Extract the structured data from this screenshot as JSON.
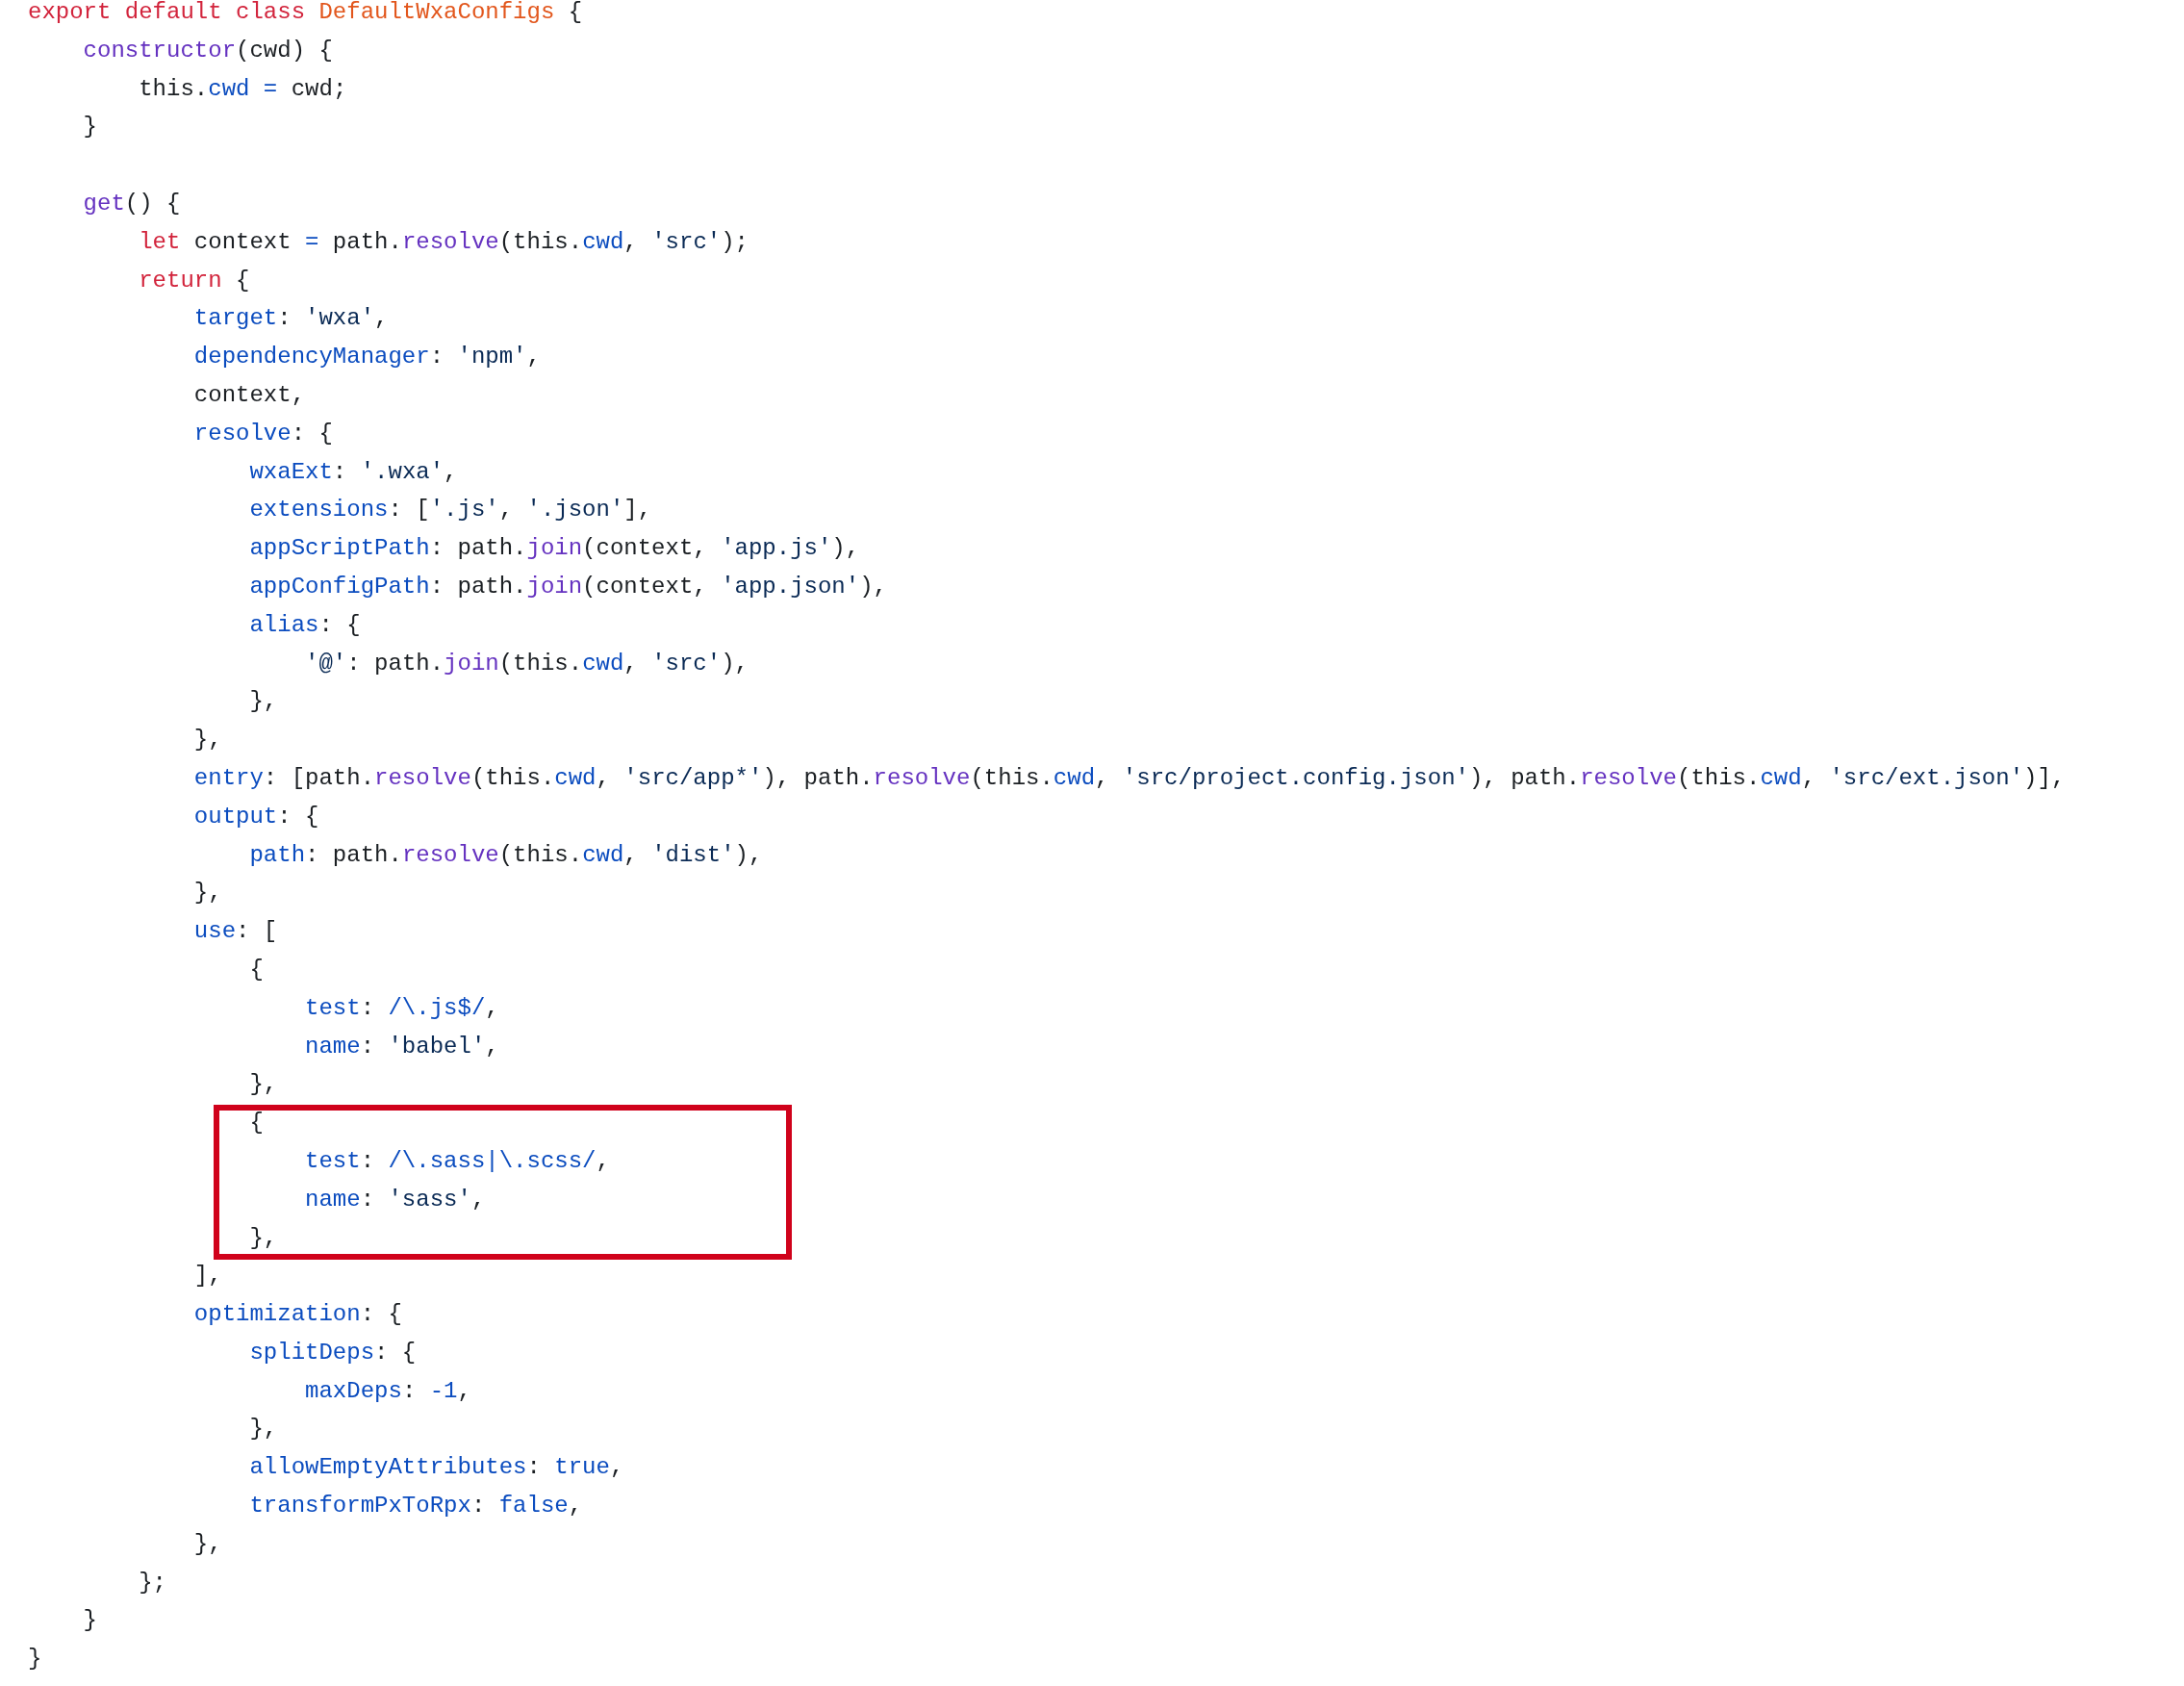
{
  "code": {
    "lines": [
      {
        "kind": "code",
        "tokens": [
          {
            "kind": "kw",
            "text": "export default class "
          },
          {
            "kind": "cls",
            "text": "DefaultWxaConfigs"
          },
          {
            "kind": "txt",
            "text": " {"
          }
        ]
      },
      {
        "kind": "code",
        "tokens": [
          {
            "kind": "fn",
            "text": "    constructor"
          },
          {
            "kind": "txt",
            "text": "(cwd) {"
          }
        ]
      },
      {
        "kind": "code",
        "tokens": [
          {
            "kind": "txt",
            "text": "        this."
          },
          {
            "kind": "prop",
            "text": "cwd"
          },
          {
            "kind": "num",
            "text": " ="
          },
          {
            "kind": "txt",
            "text": " cwd;"
          }
        ]
      },
      {
        "kind": "code",
        "tokens": [
          {
            "kind": "txt",
            "text": "    }"
          }
        ]
      },
      {
        "kind": "blank"
      },
      {
        "kind": "code",
        "tokens": [
          {
            "kind": "fn",
            "text": "    get"
          },
          {
            "kind": "txt",
            "text": "() {"
          }
        ]
      },
      {
        "kind": "code",
        "tokens": [
          {
            "kind": "kw",
            "text": "        let"
          },
          {
            "kind": "txt",
            "text": " context"
          },
          {
            "kind": "num",
            "text": " ="
          },
          {
            "kind": "txt",
            "text": " path."
          },
          {
            "kind": "fn",
            "text": "resolve"
          },
          {
            "kind": "txt",
            "text": "(this."
          },
          {
            "kind": "prop",
            "text": "cwd"
          },
          {
            "kind": "txt",
            "text": ","
          },
          {
            "kind": "str",
            "text": " 'src'"
          },
          {
            "kind": "txt",
            "text": ");"
          }
        ]
      },
      {
        "kind": "code",
        "tokens": [
          {
            "kind": "kw",
            "text": "        return"
          },
          {
            "kind": "txt",
            "text": " {"
          }
        ]
      },
      {
        "kind": "code",
        "tokens": [
          {
            "kind": "prop",
            "text": "            target"
          },
          {
            "kind": "txt",
            "text": ":"
          },
          {
            "kind": "str",
            "text": " 'wxa'"
          },
          {
            "kind": "txt",
            "text": ","
          }
        ]
      },
      {
        "kind": "code",
        "tokens": [
          {
            "kind": "prop",
            "text": "            dependencyManager"
          },
          {
            "kind": "txt",
            "text": ":"
          },
          {
            "kind": "str",
            "text": " 'npm'"
          },
          {
            "kind": "txt",
            "text": ","
          }
        ]
      },
      {
        "kind": "code",
        "tokens": [
          {
            "kind": "txt",
            "text": "            context,"
          }
        ]
      },
      {
        "kind": "code",
        "tokens": [
          {
            "kind": "prop",
            "text": "            resolve"
          },
          {
            "kind": "txt",
            "text": ": {"
          }
        ]
      },
      {
        "kind": "code",
        "tokens": [
          {
            "kind": "prop",
            "text": "                wxaExt"
          },
          {
            "kind": "txt",
            "text": ":"
          },
          {
            "kind": "str",
            "text": " '.wxa'"
          },
          {
            "kind": "txt",
            "text": ","
          }
        ]
      },
      {
        "kind": "code",
        "tokens": [
          {
            "kind": "prop",
            "text": "                extensions"
          },
          {
            "kind": "txt",
            "text": ": ["
          },
          {
            "kind": "str",
            "text": "'.js'"
          },
          {
            "kind": "txt",
            "text": ","
          },
          {
            "kind": "str",
            "text": " '.json'"
          },
          {
            "kind": "txt",
            "text": "],"
          }
        ]
      },
      {
        "kind": "code",
        "tokens": [
          {
            "kind": "prop",
            "text": "                appScriptPath"
          },
          {
            "kind": "txt",
            "text": ": path."
          },
          {
            "kind": "fn",
            "text": "join"
          },
          {
            "kind": "txt",
            "text": "(context,"
          },
          {
            "kind": "str",
            "text": " 'app.js'"
          },
          {
            "kind": "txt",
            "text": "),"
          }
        ]
      },
      {
        "kind": "code",
        "tokens": [
          {
            "kind": "prop",
            "text": "                appConfigPath"
          },
          {
            "kind": "txt",
            "text": ": path."
          },
          {
            "kind": "fn",
            "text": "join"
          },
          {
            "kind": "txt",
            "text": "(context,"
          },
          {
            "kind": "str",
            "text": " 'app.json'"
          },
          {
            "kind": "txt",
            "text": "),"
          }
        ]
      },
      {
        "kind": "code",
        "tokens": [
          {
            "kind": "prop",
            "text": "                alias"
          },
          {
            "kind": "txt",
            "text": ": {"
          }
        ]
      },
      {
        "kind": "code",
        "tokens": [
          {
            "kind": "str",
            "text": "                    '@'"
          },
          {
            "kind": "txt",
            "text": ": path."
          },
          {
            "kind": "fn",
            "text": "join"
          },
          {
            "kind": "txt",
            "text": "(this."
          },
          {
            "kind": "prop",
            "text": "cwd"
          },
          {
            "kind": "txt",
            "text": ","
          },
          {
            "kind": "str",
            "text": " 'src'"
          },
          {
            "kind": "txt",
            "text": "),"
          }
        ]
      },
      {
        "kind": "code",
        "tokens": [
          {
            "kind": "txt",
            "text": "                },"
          }
        ]
      },
      {
        "kind": "code",
        "tokens": [
          {
            "kind": "txt",
            "text": "            },"
          }
        ]
      },
      {
        "kind": "code",
        "tokens": [
          {
            "kind": "prop",
            "text": "            entry"
          },
          {
            "kind": "txt",
            "text": ": [path."
          },
          {
            "kind": "fn",
            "text": "resolve"
          },
          {
            "kind": "txt",
            "text": "(this."
          },
          {
            "kind": "prop",
            "text": "cwd"
          },
          {
            "kind": "txt",
            "text": ","
          },
          {
            "kind": "str",
            "text": " 'src/app*'"
          },
          {
            "kind": "txt",
            "text": "), path."
          },
          {
            "kind": "fn",
            "text": "resolve"
          },
          {
            "kind": "txt",
            "text": "(this."
          },
          {
            "kind": "prop",
            "text": "cwd"
          },
          {
            "kind": "txt",
            "text": ","
          },
          {
            "kind": "str",
            "text": " 'src/project.config.json'"
          },
          {
            "kind": "txt",
            "text": "), path."
          },
          {
            "kind": "fn",
            "text": "resolve"
          },
          {
            "kind": "txt",
            "text": "(this."
          },
          {
            "kind": "prop",
            "text": "cwd"
          },
          {
            "kind": "txt",
            "text": ","
          },
          {
            "kind": "str",
            "text": " 'src/ext.json'"
          },
          {
            "kind": "txt",
            "text": ")],"
          }
        ]
      },
      {
        "kind": "code",
        "tokens": [
          {
            "kind": "prop",
            "text": "            output"
          },
          {
            "kind": "txt",
            "text": ": {"
          }
        ]
      },
      {
        "kind": "code",
        "tokens": [
          {
            "kind": "prop",
            "text": "                path"
          },
          {
            "kind": "txt",
            "text": ": path."
          },
          {
            "kind": "fn",
            "text": "resolve"
          },
          {
            "kind": "txt",
            "text": "(this."
          },
          {
            "kind": "prop",
            "text": "cwd"
          },
          {
            "kind": "txt",
            "text": ","
          },
          {
            "kind": "str",
            "text": " 'dist'"
          },
          {
            "kind": "txt",
            "text": "),"
          }
        ]
      },
      {
        "kind": "code",
        "tokens": [
          {
            "kind": "txt",
            "text": "            },"
          }
        ]
      },
      {
        "kind": "code",
        "tokens": [
          {
            "kind": "prop",
            "text": "            use"
          },
          {
            "kind": "txt",
            "text": ": ["
          }
        ]
      },
      {
        "kind": "code",
        "tokens": [
          {
            "kind": "txt",
            "text": "                {"
          }
        ]
      },
      {
        "kind": "code",
        "tokens": [
          {
            "kind": "prop",
            "text": "                    test"
          },
          {
            "kind": "txt",
            "text": ":"
          },
          {
            "kind": "num",
            "text": " /\\.js$/"
          },
          {
            "kind": "txt",
            "text": ","
          }
        ]
      },
      {
        "kind": "code",
        "tokens": [
          {
            "kind": "prop",
            "text": "                    name"
          },
          {
            "kind": "txt",
            "text": ":"
          },
          {
            "kind": "str",
            "text": " 'babel'"
          },
          {
            "kind": "txt",
            "text": ","
          }
        ]
      },
      {
        "kind": "code",
        "tokens": [
          {
            "kind": "txt",
            "text": "                },"
          }
        ]
      },
      {
        "kind": "code",
        "boxed": true,
        "tokens": [
          {
            "kind": "txt",
            "text": "                {"
          }
        ]
      },
      {
        "kind": "code",
        "boxed": true,
        "tokens": [
          {
            "kind": "prop",
            "text": "                    test"
          },
          {
            "kind": "txt",
            "text": ":"
          },
          {
            "kind": "num",
            "text": " /\\.sass|\\.scss/"
          },
          {
            "kind": "txt",
            "text": ","
          }
        ]
      },
      {
        "kind": "code",
        "boxed": true,
        "tokens": [
          {
            "kind": "prop",
            "text": "                    name"
          },
          {
            "kind": "txt",
            "text": ":"
          },
          {
            "kind": "str",
            "text": " 'sass'"
          },
          {
            "kind": "txt",
            "text": ","
          }
        ]
      },
      {
        "kind": "code",
        "boxed": true,
        "tokens": [
          {
            "kind": "txt",
            "text": "                },"
          }
        ]
      },
      {
        "kind": "code",
        "tokens": [
          {
            "kind": "txt",
            "text": "            ],"
          }
        ]
      },
      {
        "kind": "code",
        "tokens": [
          {
            "kind": "prop",
            "text": "            optimization"
          },
          {
            "kind": "txt",
            "text": ": {"
          }
        ]
      },
      {
        "kind": "code",
        "tokens": [
          {
            "kind": "prop",
            "text": "                splitDeps"
          },
          {
            "kind": "txt",
            "text": ": {"
          }
        ]
      },
      {
        "kind": "code",
        "tokens": [
          {
            "kind": "prop",
            "text": "                    maxDeps"
          },
          {
            "kind": "txt",
            "text": ":"
          },
          {
            "kind": "num",
            "text": " -1"
          },
          {
            "kind": "txt",
            "text": ","
          }
        ]
      },
      {
        "kind": "code",
        "tokens": [
          {
            "kind": "txt",
            "text": "                },"
          }
        ]
      },
      {
        "kind": "code",
        "tokens": [
          {
            "kind": "prop",
            "text": "                allowEmptyAttributes"
          },
          {
            "kind": "txt",
            "text": ":"
          },
          {
            "kind": "num",
            "text": " true"
          },
          {
            "kind": "txt",
            "text": ","
          }
        ]
      },
      {
        "kind": "code",
        "tokens": [
          {
            "kind": "prop",
            "text": "                transformPxToRpx"
          },
          {
            "kind": "txt",
            "text": ":"
          },
          {
            "kind": "num",
            "text": " false"
          },
          {
            "kind": "txt",
            "text": ","
          }
        ]
      },
      {
        "kind": "code",
        "tokens": [
          {
            "kind": "txt",
            "text": "            },"
          }
        ]
      },
      {
        "kind": "code",
        "tokens": [
          {
            "kind": "txt",
            "text": "        };"
          }
        ]
      },
      {
        "kind": "code",
        "tokens": [
          {
            "kind": "txt",
            "text": "    }"
          }
        ]
      },
      {
        "kind": "code",
        "tokens": [
          {
            "kind": "txt",
            "text": "}"
          }
        ]
      }
    ]
  }
}
